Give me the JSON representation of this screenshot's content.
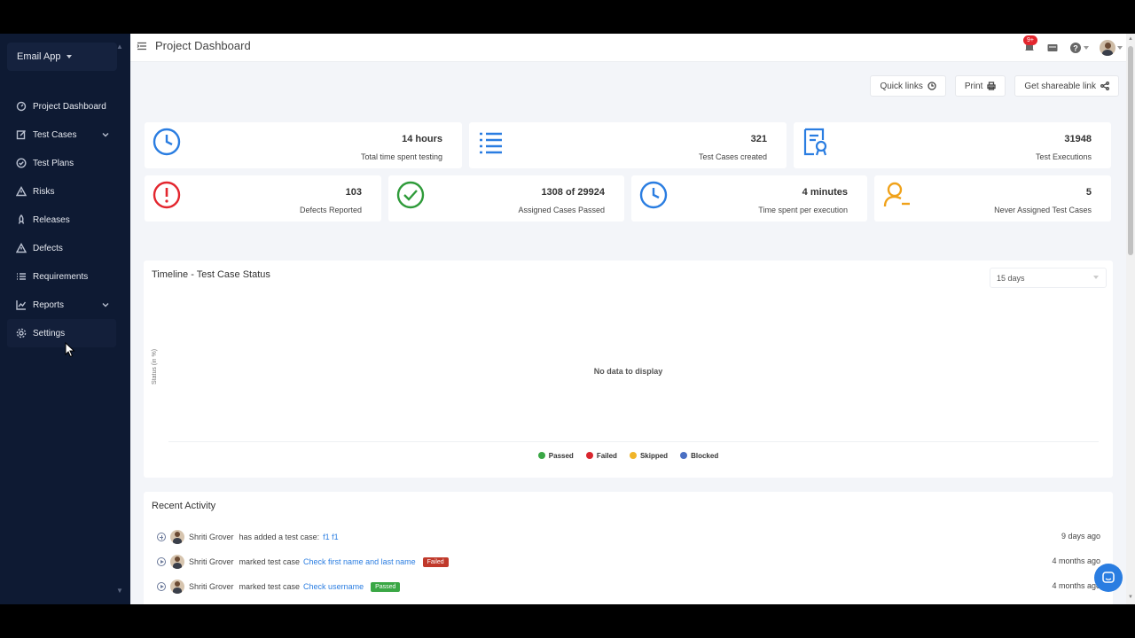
{
  "sidebar": {
    "project": "Email App",
    "items": [
      {
        "label": "Project Dashboard",
        "icon": "dashboard-icon",
        "has_children": false
      },
      {
        "label": "Test Cases",
        "icon": "edit-icon",
        "has_children": true
      },
      {
        "label": "Test Plans",
        "icon": "check-circle-icon",
        "has_children": false
      },
      {
        "label": "Risks",
        "icon": "warning-icon",
        "has_children": false
      },
      {
        "label": "Releases",
        "icon": "rocket-icon",
        "has_children": false
      },
      {
        "label": "Defects",
        "icon": "warning-icon",
        "has_children": false
      },
      {
        "label": "Requirements",
        "icon": "list-icon",
        "has_children": false
      },
      {
        "label": "Reports",
        "icon": "chart-icon",
        "has_children": true
      },
      {
        "label": "Settings",
        "icon": "gear-icon",
        "has_children": false
      }
    ]
  },
  "header": {
    "title": "Project Dashboard",
    "notification_badge": "9+"
  },
  "actions": {
    "quick_links": "Quick links",
    "print": "Print",
    "share": "Get shareable link"
  },
  "stats": [
    {
      "value": "14 hours",
      "label": "Total time spent testing",
      "icon": "clock-icon",
      "color": "#2a7de1"
    },
    {
      "value": "321",
      "label": "Test Cases created",
      "icon": "list-icon",
      "color": "#2a7de1"
    },
    {
      "value": "31948",
      "label": "Test Executions",
      "icon": "certificate-icon",
      "color": "#2a7de1"
    },
    {
      "value": "103",
      "label": "Defects Reported",
      "icon": "alert-circle-icon",
      "color": "#e3262e"
    },
    {
      "value": "1308 of 29924",
      "label": "Assigned Cases Passed",
      "icon": "check-circle-icon",
      "color": "#2f9b3a"
    },
    {
      "value": "4 minutes",
      "label": "Time spent per execution",
      "icon": "clock-icon",
      "color": "#2a7de1"
    },
    {
      "value": "5",
      "label": "Never Assigned Test Cases",
      "icon": "user-minus-icon",
      "color": "#f0a21a"
    }
  ],
  "timeline": {
    "title": "Timeline - Test Case Status",
    "range": "15 days",
    "y_label": "Status (in %)",
    "empty_text": "No data to display",
    "legend": [
      {
        "label": "Passed",
        "color": "#3aa745"
      },
      {
        "label": "Failed",
        "color": "#d9262e"
      },
      {
        "label": "Skipped",
        "color": "#f0b429"
      },
      {
        "label": "Blocked",
        "color": "#4a6fc3"
      }
    ]
  },
  "activity": {
    "title": "Recent Activity",
    "rows": [
      {
        "user": "Shriti Grover",
        "action": "has added a test case:",
        "link": "f1 f1",
        "tag": "",
        "time": "9 days ago"
      },
      {
        "user": "Shriti Grover",
        "action": "marked test case",
        "link": "Check first name and last name",
        "tag": "Failed",
        "time": "4 months ago"
      },
      {
        "user": "Shriti Grover",
        "action": "marked test case",
        "link": "Check username",
        "tag": "Passed",
        "time": "4 months ago"
      }
    ]
  }
}
